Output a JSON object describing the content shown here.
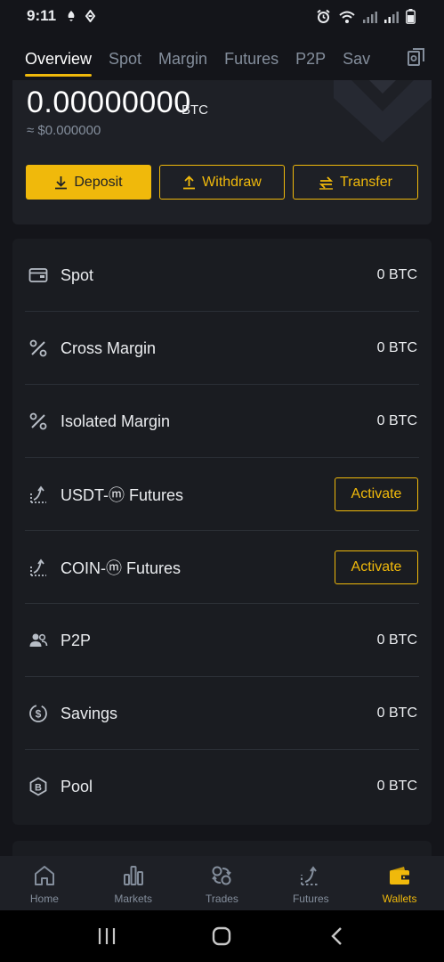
{
  "status_bar": {
    "time": "9:11",
    "left_icons": [
      "notification-icon",
      "nfc-icon"
    ],
    "right_icons": [
      "alarm-icon",
      "wifi-icon",
      "signal-icon",
      "signal-icon",
      "battery-icon"
    ]
  },
  "tabs": [
    {
      "label": "Overview",
      "active": true
    },
    {
      "label": "Spot"
    },
    {
      "label": "Margin"
    },
    {
      "label": "Futures"
    },
    {
      "label": "P2P"
    },
    {
      "label": "Sav"
    }
  ],
  "balance": {
    "amount": "0.00000000",
    "unit": "BTC",
    "fiat": "≈ $0.000000"
  },
  "actions": {
    "deposit": "Deposit",
    "withdraw": "Withdraw",
    "transfer": "Transfer"
  },
  "wallets": [
    {
      "label": "Spot",
      "value": "0 BTC",
      "icon": "wallet-icon"
    },
    {
      "label": "Cross Margin",
      "value": "0 BTC",
      "icon": "percent-icon"
    },
    {
      "label": "Isolated Margin",
      "value": "0 BTC",
      "icon": "percent-icon"
    },
    {
      "label": "USDT-ⓜ Futures",
      "action": "Activate",
      "icon": "futures-icon"
    },
    {
      "label": "COIN-ⓜ Futures",
      "action": "Activate",
      "icon": "futures-icon"
    },
    {
      "label": "P2P",
      "value": "0 BTC",
      "icon": "users-icon"
    },
    {
      "label": "Savings",
      "value": "0 BTC",
      "icon": "savings-icon"
    },
    {
      "label": "Pool",
      "value": "0 BTC",
      "icon": "pool-icon"
    }
  ],
  "bottom_nav": [
    {
      "label": "Home",
      "icon": "home-icon"
    },
    {
      "label": "Markets",
      "icon": "markets-icon"
    },
    {
      "label": "Trades",
      "icon": "trades-icon"
    },
    {
      "label": "Futures",
      "icon": "futures-icon"
    },
    {
      "label": "Wallets",
      "icon": "wallet-icon",
      "active": true
    }
  ],
  "colors": {
    "accent": "#f0b90b",
    "background": "#14151a",
    "card": "#1e2026",
    "text_primary": "#eaecef",
    "text_secondary": "#848e9c"
  }
}
